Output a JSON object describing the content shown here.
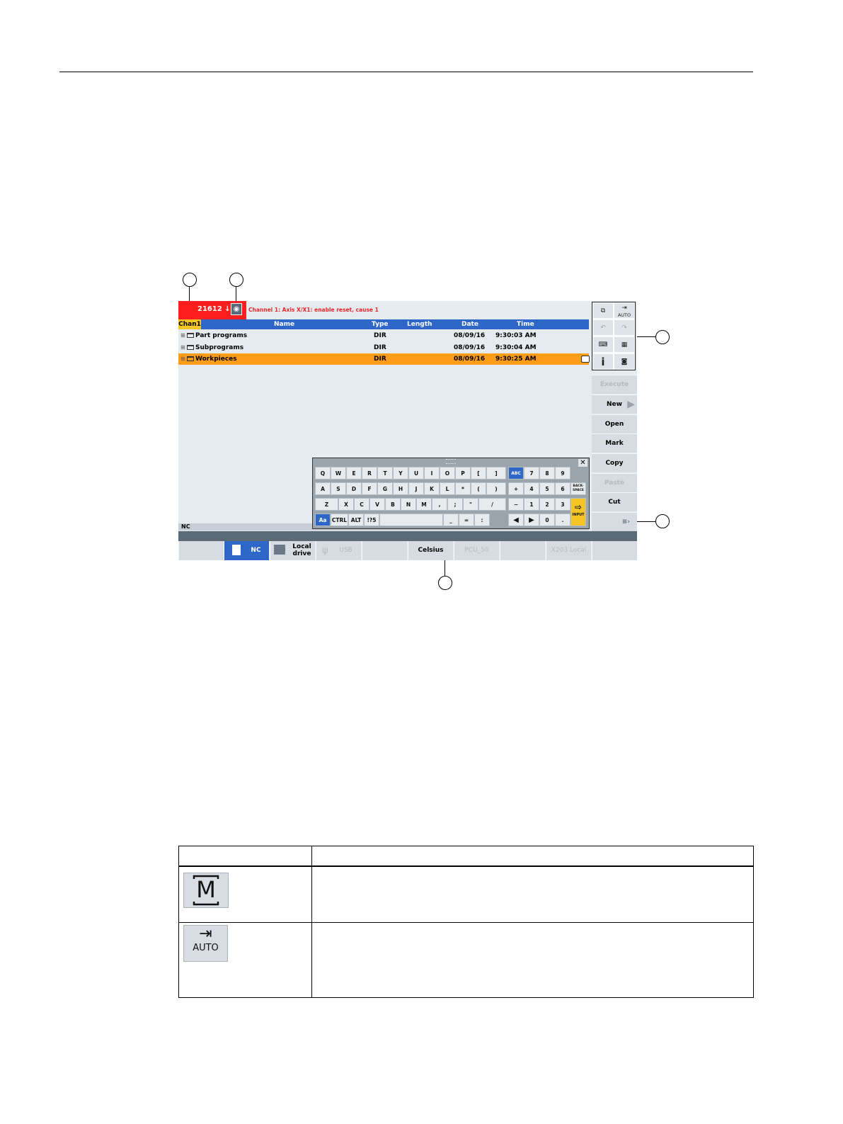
{
  "callouts": [
    "",
    "",
    "",
    "",
    ""
  ],
  "alarm": {
    "number": "21612",
    "arrow": "↓",
    "message": "Channel 1: Axis X/X1: enable reset, cause 1"
  },
  "channel": "Chan1",
  "columns": [
    "Name",
    "Type",
    "Length",
    "Date",
    "Time"
  ],
  "rows": [
    {
      "name": "Part programs",
      "type": "DIR",
      "length": "",
      "date": "08/09/16",
      "time": "9:30:03 AM"
    },
    {
      "name": "Subprograms",
      "type": "DIR",
      "length": "",
      "date": "08/09/16",
      "time": "9:30:04 AM"
    },
    {
      "name": "Workpieces",
      "type": "DIR",
      "length": "",
      "date": "08/09/16",
      "time": "9:30:25 AM"
    }
  ],
  "toolbox": {
    "auto_label": "AUTO",
    "info": "i"
  },
  "vertical_softkeys": [
    "Execute",
    "New",
    "Open",
    "Mark",
    "Copy",
    "Paste",
    "Cut"
  ],
  "status_line": "NC",
  "horizontal_softkeys": [
    "",
    "NC",
    "Local drive",
    "USB",
    "",
    "Celsius",
    "PCU_50",
    "",
    "X203 Local",
    ""
  ],
  "keyboard": {
    "row1": [
      "Q",
      "W",
      "E",
      "R",
      "T",
      "Y",
      "U",
      "I",
      "O",
      "P",
      "[",
      "]"
    ],
    "row2": [
      "A",
      "S",
      "D",
      "F",
      "G",
      "H",
      "J",
      "K",
      "L",
      "*",
      "(",
      ")"
    ],
    "row3": [
      "Z",
      "X",
      "C",
      "V",
      "B",
      "N",
      "M",
      ",",
      ";",
      "\"",
      "/"
    ],
    "row4_left": [
      "Aa",
      "CTRL",
      "ALT",
      "!?5"
    ],
    "row4_right": [
      "_",
      "=",
      ":"
    ],
    "abc": "ABC",
    "num1": [
      "7",
      "8",
      "9"
    ],
    "num2": [
      "+",
      "4",
      "5",
      "6"
    ],
    "num3": [
      "−",
      "1",
      "2",
      "3"
    ],
    "num4": [
      "◀",
      "▶",
      "0",
      "."
    ],
    "backspace": "BACK-SPACE",
    "input": "INPUT",
    "close": "✕"
  },
  "table": {
    "icon_m": "M",
    "icon_auto": "AUTO"
  }
}
